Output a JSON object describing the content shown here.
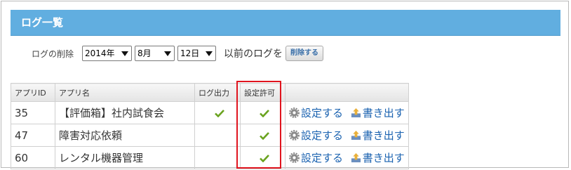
{
  "header": {
    "title": "ログ一覧"
  },
  "delete_row": {
    "label": "ログの削除",
    "year": "2014年",
    "month": "8月",
    "day": "12日",
    "before_text": "以前のログを",
    "button": "削除する"
  },
  "table": {
    "columns": [
      "アプリID",
      "アプリ名",
      "ログ出力",
      "設定許可"
    ],
    "rows": [
      {
        "id": "35",
        "name": "【評価箱】社内試食会",
        "log_output": true,
        "permission": true,
        "settings": "設定する",
        "export": "書き出す"
      },
      {
        "id": "47",
        "name": "障害対応依頼",
        "log_output": false,
        "permission": true,
        "settings": "設定する",
        "export": "書き出す"
      },
      {
        "id": "60",
        "name": "レンタル機器管理",
        "log_output": false,
        "permission": true,
        "settings": "設定する",
        "export": "書き出す"
      }
    ]
  },
  "colors": {
    "header_bg": "#61aee0",
    "check": "#6aa31f",
    "highlight": "#e0141e",
    "link": "#1a62b0"
  },
  "icons": [
    "check-icon",
    "gear-icon",
    "export-icon"
  ]
}
